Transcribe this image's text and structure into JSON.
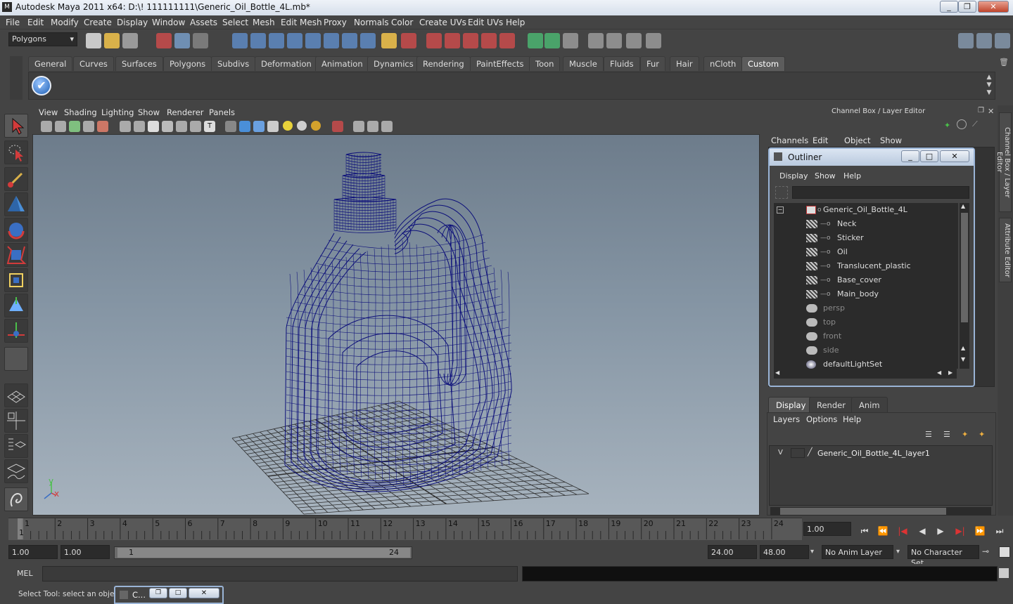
{
  "window": {
    "title": "Autodesk Maya 2011 x64: D:\\! 111111111\\Generic_Oil_Bottle_4L.mb*",
    "app_icon": "maya-icon",
    "controls": [
      "minimize",
      "restore",
      "close"
    ]
  },
  "menubar": [
    "File",
    "Edit",
    "Modify",
    "Create",
    "Display",
    "Window",
    "Assets",
    "Select",
    "Mesh",
    "Edit Mesh",
    "Proxy",
    "Normals",
    "Color",
    "Create UVs",
    "Edit UVs",
    "Help"
  ],
  "statusline": {
    "menu_set": "Polygons"
  },
  "shelf": {
    "tabs": [
      "General",
      "Curves",
      "Surfaces",
      "Polygons",
      "Subdivs",
      "Deformation",
      "Animation",
      "Dynamics",
      "Rendering",
      "PaintEffects",
      "Toon",
      "Muscle",
      "Fluids",
      "Fur",
      "Hair",
      "nCloth",
      "Custom"
    ],
    "active_tab": "Custom",
    "button_icon": "checkmark-icon"
  },
  "viewport": {
    "menus": [
      "View",
      "Shading",
      "Lighting",
      "Show",
      "Renderer",
      "Panels"
    ],
    "axis_labels": {
      "y": "y",
      "x": "x"
    }
  },
  "channel_box": {
    "header": "Channel Box / Layer Editor",
    "menus": [
      "Channels",
      "Edit",
      "Object",
      "Show"
    ]
  },
  "outliner": {
    "title": "Outliner",
    "menus": [
      "Display",
      "Show",
      "Help"
    ],
    "root": "Generic_Oil_Bottle_4L",
    "children": [
      "Neck",
      "Sticker",
      "Oil",
      "Translucent_plastic",
      "Base_cover",
      "Main_body"
    ],
    "cameras": [
      "persp",
      "top",
      "front",
      "side"
    ],
    "sets": [
      "defaultLightSet"
    ]
  },
  "layer_editor": {
    "tabs": [
      "Display",
      "Render",
      "Anim"
    ],
    "active_tab": "Display",
    "menus": [
      "Layers",
      "Options",
      "Help"
    ],
    "layer": {
      "visible": "V",
      "name": "Generic_Oil_Bottle_4L_layer1"
    }
  },
  "side_tabs": [
    "Channel Box / Layer Editor",
    "Attribute Editor"
  ],
  "time_slider": {
    "ticks": [
      "1",
      "2",
      "3",
      "4",
      "5",
      "6",
      "7",
      "8",
      "9",
      "10",
      "11",
      "12",
      "13",
      "14",
      "15",
      "16",
      "17",
      "18",
      "19",
      "20",
      "21",
      "22",
      "23",
      "24"
    ],
    "current_frame_marker": "1",
    "current_time": "1.00"
  },
  "range_slider": {
    "start_time": "1.00",
    "playback_start": "1.00",
    "range_start_label": "1",
    "range_end_label": "24",
    "playback_end": "24.00",
    "end_time": "48.00",
    "anim_layer": "No Anim Layer",
    "character_set": "No Character Set"
  },
  "command_line": {
    "label": "MEL"
  },
  "help_line": {
    "text": "Select Tool: select an object",
    "minimized_window_label": "C..."
  },
  "colors": {
    "wireframe": "#0c0f7a",
    "grid": "#2e2e2e",
    "ui_bg": "#444444",
    "field_bg": "#2b2b2b"
  }
}
